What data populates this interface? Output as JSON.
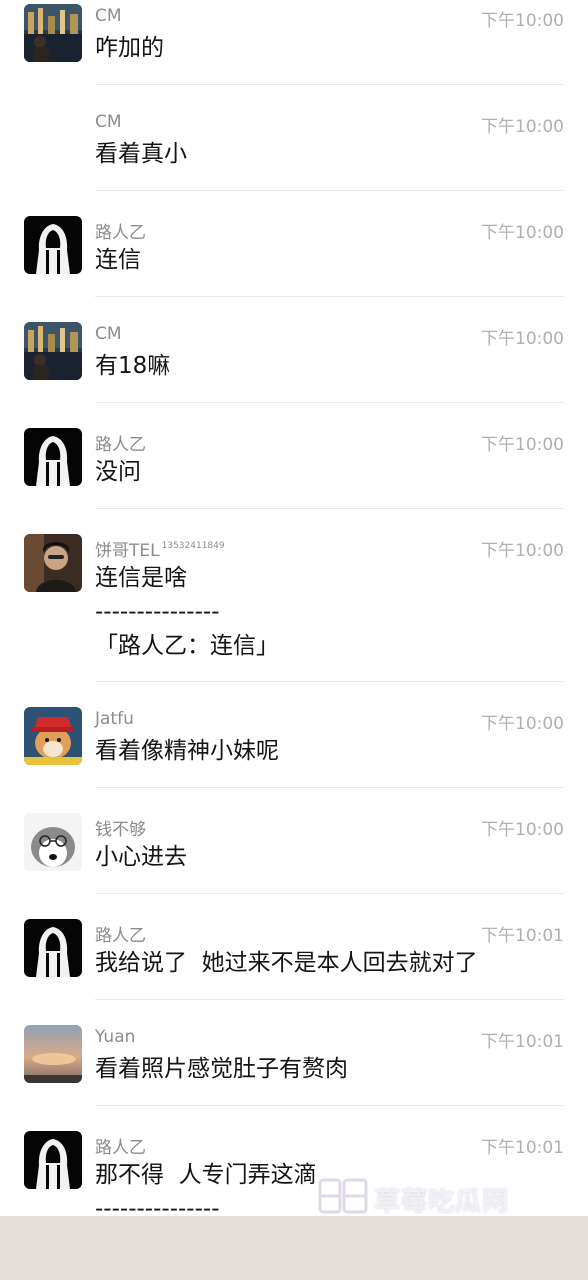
{
  "messages": [
    {
      "sender": "CM",
      "time": "下午10:00",
      "avatar": "cm-city-night",
      "lines": [
        "咋加的"
      ]
    },
    {
      "sender": "CM",
      "time": "下午10:00",
      "avatar": "",
      "lines": [
        "看着真小"
      ]
    },
    {
      "sender": "路人乙",
      "time": "下午10:00",
      "avatar": "hooded-figure",
      "lines": [
        "连信"
      ]
    },
    {
      "sender": "CM",
      "time": "下午10:00",
      "avatar": "cm-city-night",
      "lines": [
        "有18嘛"
      ]
    },
    {
      "sender": "路人乙",
      "time": "下午10:00",
      "avatar": "hooded-figure",
      "lines": [
        "没问"
      ]
    },
    {
      "sender": "饼哥TEL",
      "sender_sup": "13532411849",
      "time": "下午10:00",
      "avatar": "portrait-man",
      "lines": [
        "连信是啥",
        "---------------",
        "「路人乙：连信」"
      ]
    },
    {
      "sender": "Jatfu",
      "time": "下午10:00",
      "avatar": "shiba-red-hat",
      "lines": [
        "看着像精神小妹呢"
      ]
    },
    {
      "sender": "钱不够",
      "time": "下午10:00",
      "avatar": "husky-glasses",
      "lines": [
        "小心进去"
      ]
    },
    {
      "sender": "路人乙",
      "time": "下午10:01",
      "avatar": "hooded-figure",
      "lines": [
        "我给说了  她过来不是本人回去就对了"
      ]
    },
    {
      "sender": "Yuan",
      "time": "下午10:01",
      "avatar": "sunset-sky",
      "lines": [
        "看着照片感觉肚子有赘肉"
      ]
    },
    {
      "sender": "路人乙",
      "time": "下午10:01",
      "avatar": "hooded-figure",
      "lines": [
        "那不得  人专门弄这滴",
        "---------------"
      ]
    }
  ],
  "watermark": {
    "text": "草莓吃瓜网"
  }
}
